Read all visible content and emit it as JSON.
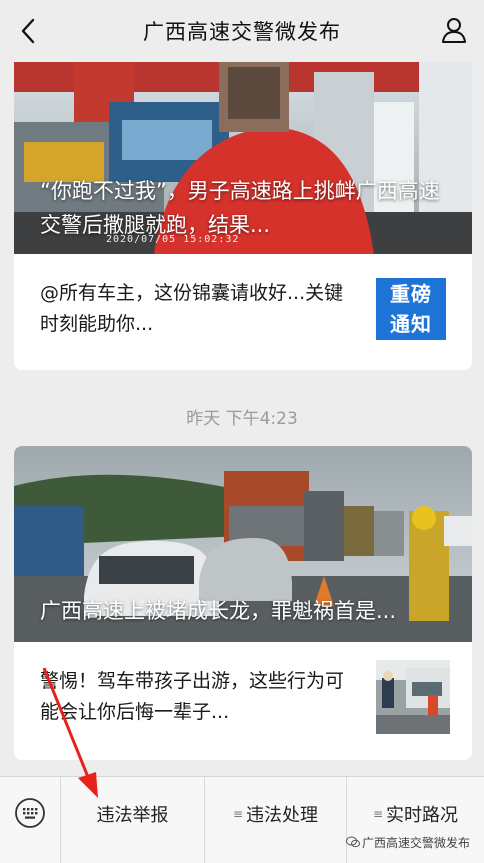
{
  "header": {
    "title": "广西高速交警微发布"
  },
  "article1": {
    "cover_title": "“你跑不过我”，男子高速路上挑衅广西高速交警后撒腿就跑，结果...",
    "timestamp_overlay": "2020/07/05  15:02:32",
    "subtitle": "@所有车主，这份锦囊请收好...关键时刻能助你...",
    "badge_line1": "重磅",
    "badge_line2": "通知"
  },
  "time_divider": "昨天 下午4:23",
  "article2": {
    "cover_title": "广西高速上被堵成长龙，罪魁祸首是...",
    "subtitle": "警惕！驾车带孩子出游，这些行为可能会让你后悔一辈子..."
  },
  "menu": {
    "item1": "违法举报",
    "item2": "违法处理",
    "item3": "实时路况"
  },
  "watermark": "广西高速交警微发布",
  "colors": {
    "accent": "#1e73d6",
    "arrow": "#e8211b"
  },
  "icons": [
    "back-arrow-icon",
    "profile-icon",
    "keyboard-icon",
    "menu-lines-icon",
    "wechat-logo-icon"
  ]
}
